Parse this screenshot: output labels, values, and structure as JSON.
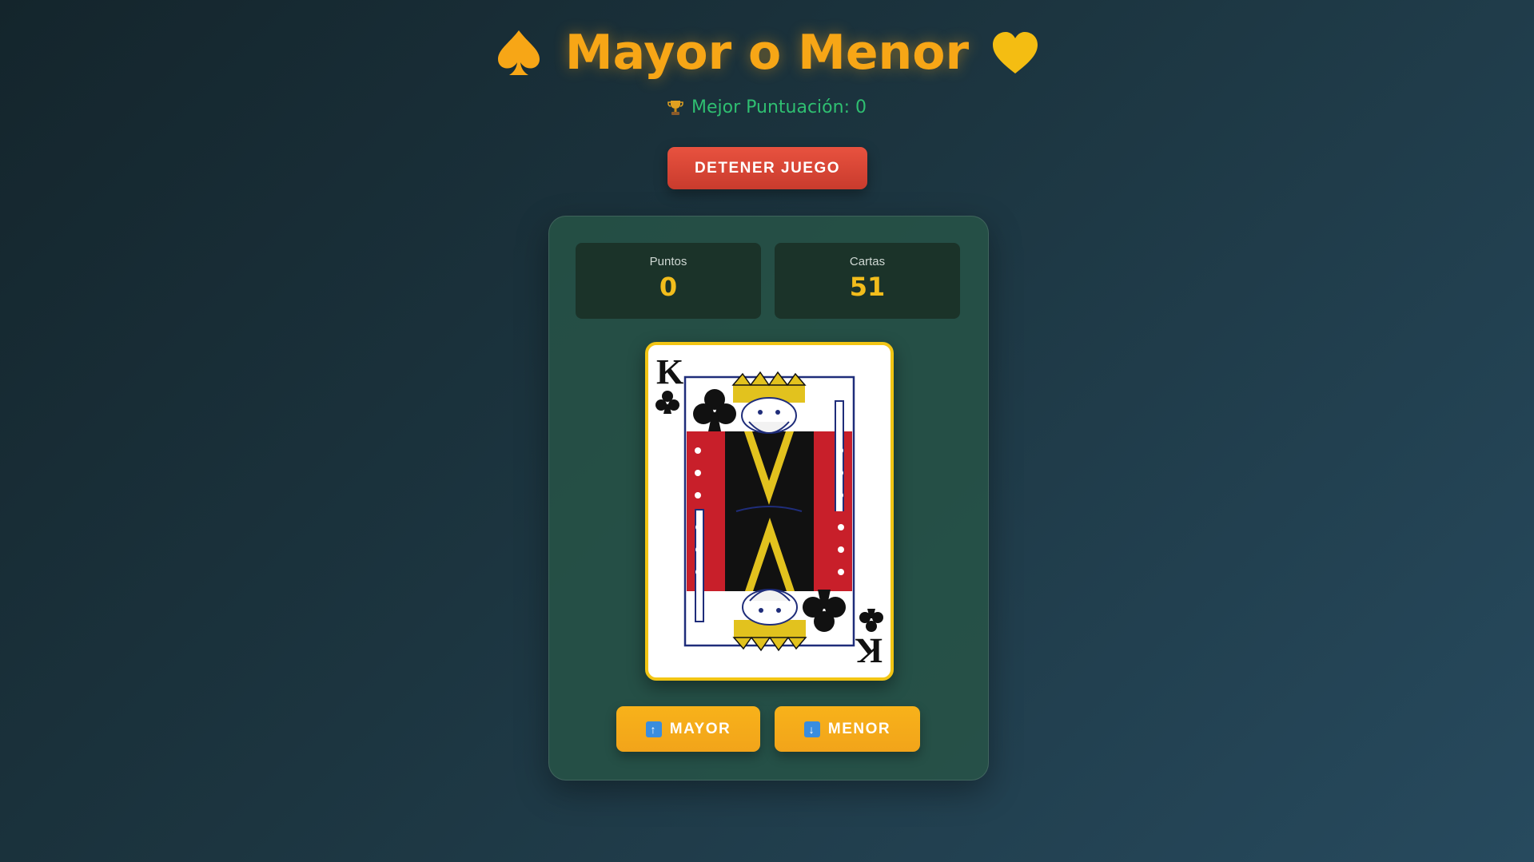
{
  "header": {
    "title": "Mayor o Menor",
    "left_icon": "spade-icon",
    "right_icon": "yellow-heart-icon",
    "best_score_icon": "trophy-icon",
    "best_score": "Mejor Puntuación: 0"
  },
  "controls": {
    "stop_label": "DETENER JUEGO"
  },
  "stats": {
    "points_label": "Puntos",
    "points_value": "0",
    "cards_label": "Cartas",
    "cards_value": "51"
  },
  "current_card": {
    "rank": "K",
    "suit": "clubs"
  },
  "actions": {
    "higher_icon": "up-arrow-icon",
    "higher_label": "MAYOR",
    "lower_icon": "down-arrow-icon",
    "lower_label": "MENOR"
  },
  "colors": {
    "accent": "#f7a616",
    "best_score": "#2fbf71",
    "stop_button": "#e14b3a",
    "card_border": "#f2c514",
    "panel": "#275446"
  }
}
